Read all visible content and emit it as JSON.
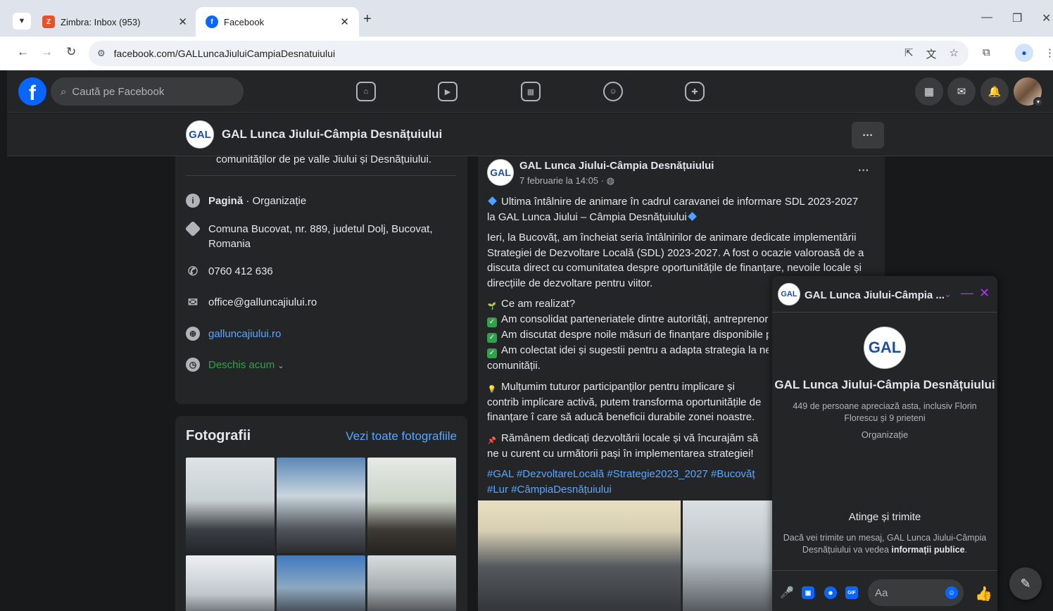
{
  "browser": {
    "tabs": [
      {
        "title": "Zimbra: Inbox (953)",
        "favicon": "zimbra-icon"
      },
      {
        "title": "Facebook",
        "favicon": "facebook-icon"
      }
    ],
    "url": "facebook.com/GALLuncaJiuluiCampiaDesnatuiului"
  },
  "fb": {
    "search_placeholder": "Caută pe Facebook",
    "page_name": "GAL Lunca Jiului-Câmpia Desnățuiului",
    "logo_text": "GAL",
    "more_label": "···"
  },
  "intro": {
    "cut_text": "comunităților de pe valle Jiului și Desnățuiului.",
    "category_bold": "Pagină",
    "category_rest": " · Organizație",
    "address": "Comuna Bucovat, nr. 889, judetul Dolj, Bucovat, Romania",
    "phone": "0760 412 636",
    "email": "office@galluncajiului.ro",
    "website": "galluncajiului.ro",
    "hours": "Deschis acum"
  },
  "photos": {
    "title": "Fotografii",
    "see_all": "Vezi toate fotografiile"
  },
  "post": {
    "author": "GAL Lunca Jiului-Câmpia Desnățuiului",
    "date": "7 februarie la 14:05 · ",
    "p1": "Ultima întâlnire de animare  în cadrul caravanei de informare SDL 2023-2027 la GAL Lunca Jiului – Câmpia Desnățuiului",
    "p2": "Ieri, la Bucovăț, am încheiat seria întâlnirilor de animare dedicate implementării Strategiei de Dezvoltare Locală (SDL) 2023-2027. A fost o ocazie valoroasă de a discuta direct cu comunitatea despre oportunitățile de finanțare, nevoile locale și direcțiile de dezvoltare pentru viitor.",
    "p3_title": "Ce am realizat?",
    "p3_items": [
      "Am consolidat parteneriatele dintre autorități, antreprenori",
      "Am discutat despre noile măsuri de finanțare disponibile pr",
      "Am colectat idei și sugestii pentru a adapta strategia la nevo"
    ],
    "p3_tail": "comunității.",
    "p4": "Mulțumim tuturor participanților pentru implicare și contrib implicare activă, putem transforma oportunitățile de finanțare î care să aducă beneficii durabile zonei noastre.",
    "p5": "Rămânem dedicați dezvoltării locale și vă încurajăm să ne u curent cu următorii pași în implementarea strategiei!",
    "hashtags": "#GAL #DezvoltareLocală #Strategie2023_2027 #Bucovăț #Lur #CâmpiaDesnățuiului"
  },
  "chat": {
    "header_name": "GAL Lunca Jiului-Câmpia ...",
    "name": "GAL Lunca Jiului-Câmpia Desnățuiului",
    "likes": "449 de persoane apreciază asta, inclusiv Florin Florescu și 9 prieteni",
    "category": "Organizație",
    "tap_send": "Atinge și trimite",
    "info_pre": "Dacă vei trimite un mesaj, GAL Lunca Jiului-Câmpia Desnățuiului va vedea ",
    "info_bold": "informații publice",
    "info_post": ".",
    "input_placeholder": "Aa"
  },
  "colors": {
    "fb_blue": "#0866ff",
    "link_blue": "#5aa7ff",
    "open_green": "#31a24c",
    "messenger_purple": "#a33cf0",
    "dark_bg": "#18191a",
    "card_bg": "#242526"
  }
}
